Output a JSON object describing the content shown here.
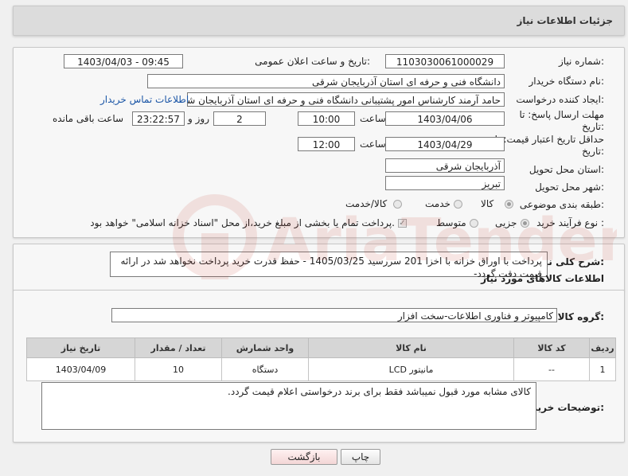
{
  "header": {
    "title": "جزئیات اطلاعات نیاز"
  },
  "form": {
    "need_number_label": "شماره نیاز:",
    "need_number": "1103030061000029",
    "announce_label": "تاریخ و ساعت اعلان عمومی:",
    "announce_value": "1403/04/03 - 09:45",
    "buyer_org_label": "نام دستگاه خریدار:",
    "buyer_org": "دانشگاه فنی و حرفه ای استان آذربایجان شرقی",
    "creator_label": "ایجاد کننده درخواست:",
    "creator": "حامد آرمند کارشناس امور پشتیبانی دانشگاه فنی و حرفه ای استان آذربایجان شرقی",
    "contact_link": "اطلاعات تماس خریدار",
    "deadline_label_1": "مهلت ارسال پاسخ: تا",
    "deadline_label_2": "تاریخ:",
    "deadline_date": "1403/04/06",
    "time_label": "ساعت",
    "deadline_time": "10:00",
    "days_value": "2",
    "days_label": "روز و",
    "remaining_value": "23:22:57",
    "remaining_label": "ساعت باقی مانده",
    "validity_label_1": "حداقل تاریخ اعتبار قیمت: تا",
    "validity_label_2": "تاریخ:",
    "validity_date": "1403/04/29",
    "validity_time": "12:00",
    "province_label": "استان محل تحویل:",
    "province": "آذربایجان شرقی",
    "city_label": "شهر محل تحویل:",
    "city": "تبریز",
    "category_label": "طبقه بندی موضوعی:",
    "category_options": [
      "کالا",
      "خدمت",
      "کالا/خدمت"
    ],
    "purchase_label": "نوع فرآیند خرید :",
    "purchase_options": [
      "جزیی",
      "متوسط"
    ],
    "purchase_note": "پرداخت تمام یا بخشی از مبلغ خرید،از محل \"اسناد خزانه اسلامی\" خواهد بود."
  },
  "summary": {
    "label": "شرح کلی نیاز:",
    "text": "پرداخت با اوراق خزانه  با اخزا 201 سررسید 1405/03/25 - حفظ قدرت خرید پرداخت نخواهد شد در ارائه قیمت دقت گردد-"
  },
  "goods": {
    "section_title": "اطلاعات کالاهای مورد نیاز",
    "group_label": "گروه کالا:",
    "group_value": "کامپیوتر و فناوری اطلاعات-سخت افزار",
    "columns": [
      "ردیف",
      "کد کالا",
      "نام کالا",
      "واحد شمارش",
      "تعداد / مقدار",
      "تاریخ نیاز"
    ],
    "rows": [
      [
        "1",
        "--",
        "مانیتور LCD",
        "دستگاه",
        "10",
        "1403/04/09"
      ]
    ]
  },
  "buyer_notes": {
    "label": "توضیحات خریدار:",
    "text": "کالای مشابه مورد قبول نمیباشد فقط برای برند درخواستی اعلام قیمت گردد."
  },
  "buttons": {
    "print": "چاپ",
    "back": "بازگشت"
  },
  "watermark": {
    "text": "AriaTender.neT"
  },
  "colors": {
    "link": "#1a55a6",
    "header_bg": "#dcdcdc",
    "watermark": "#c0392b"
  }
}
